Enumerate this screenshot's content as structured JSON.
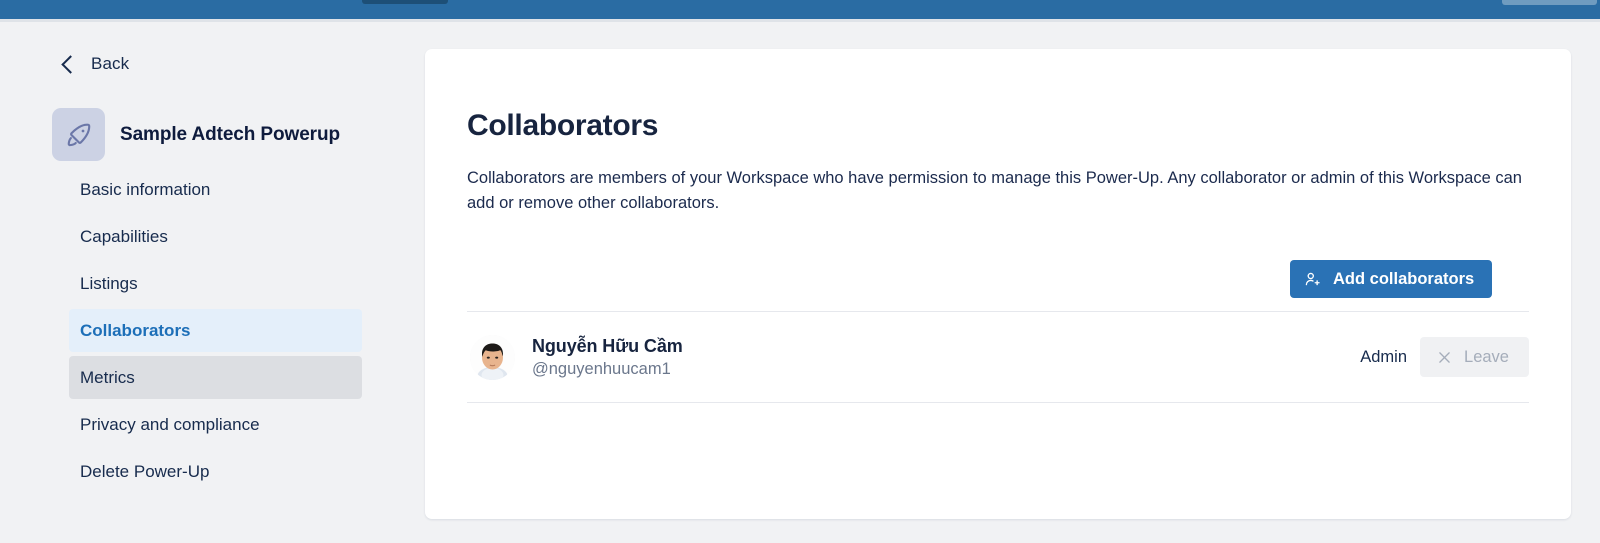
{
  "browser": {
    "bar_color": "#2a6ca3"
  },
  "sidebar": {
    "back_label": "Back",
    "back_icon": "chevron-left-icon",
    "powerup_icon": "rocket-icon",
    "powerup_title": "Sample Adtech Powerup",
    "items": [
      {
        "label": "Basic information",
        "state": "default"
      },
      {
        "label": "Capabilities",
        "state": "default"
      },
      {
        "label": "Listings",
        "state": "default"
      },
      {
        "label": "Collaborators",
        "state": "active"
      },
      {
        "label": "Metrics",
        "state": "hovered"
      },
      {
        "label": "Privacy and compliance",
        "state": "default"
      },
      {
        "label": "Delete Power-Up",
        "state": "default"
      }
    ],
    "active_color": "#1d6fb8",
    "active_bg": "#e4effa",
    "hover_bg": "#dcdee2"
  },
  "main": {
    "title": "Collaborators",
    "description": "Collaborators are members of your Workspace who have permission to manage this Power-Up. Any collaborator or admin of this Workspace can add or remove other collaborators.",
    "add_button": {
      "label": "Add collaborators",
      "icon": "person-plus-icon",
      "color": "#2a72b5"
    },
    "collaborators": [
      {
        "avatar_icon": "user-photo-avatar",
        "name": "Nguyễn Hữu Cầm",
        "handle": "@nguyenhuucam1",
        "role": "Admin",
        "action_label": "Leave",
        "action_icon": "close-x-icon",
        "action_disabled": true
      }
    ]
  }
}
